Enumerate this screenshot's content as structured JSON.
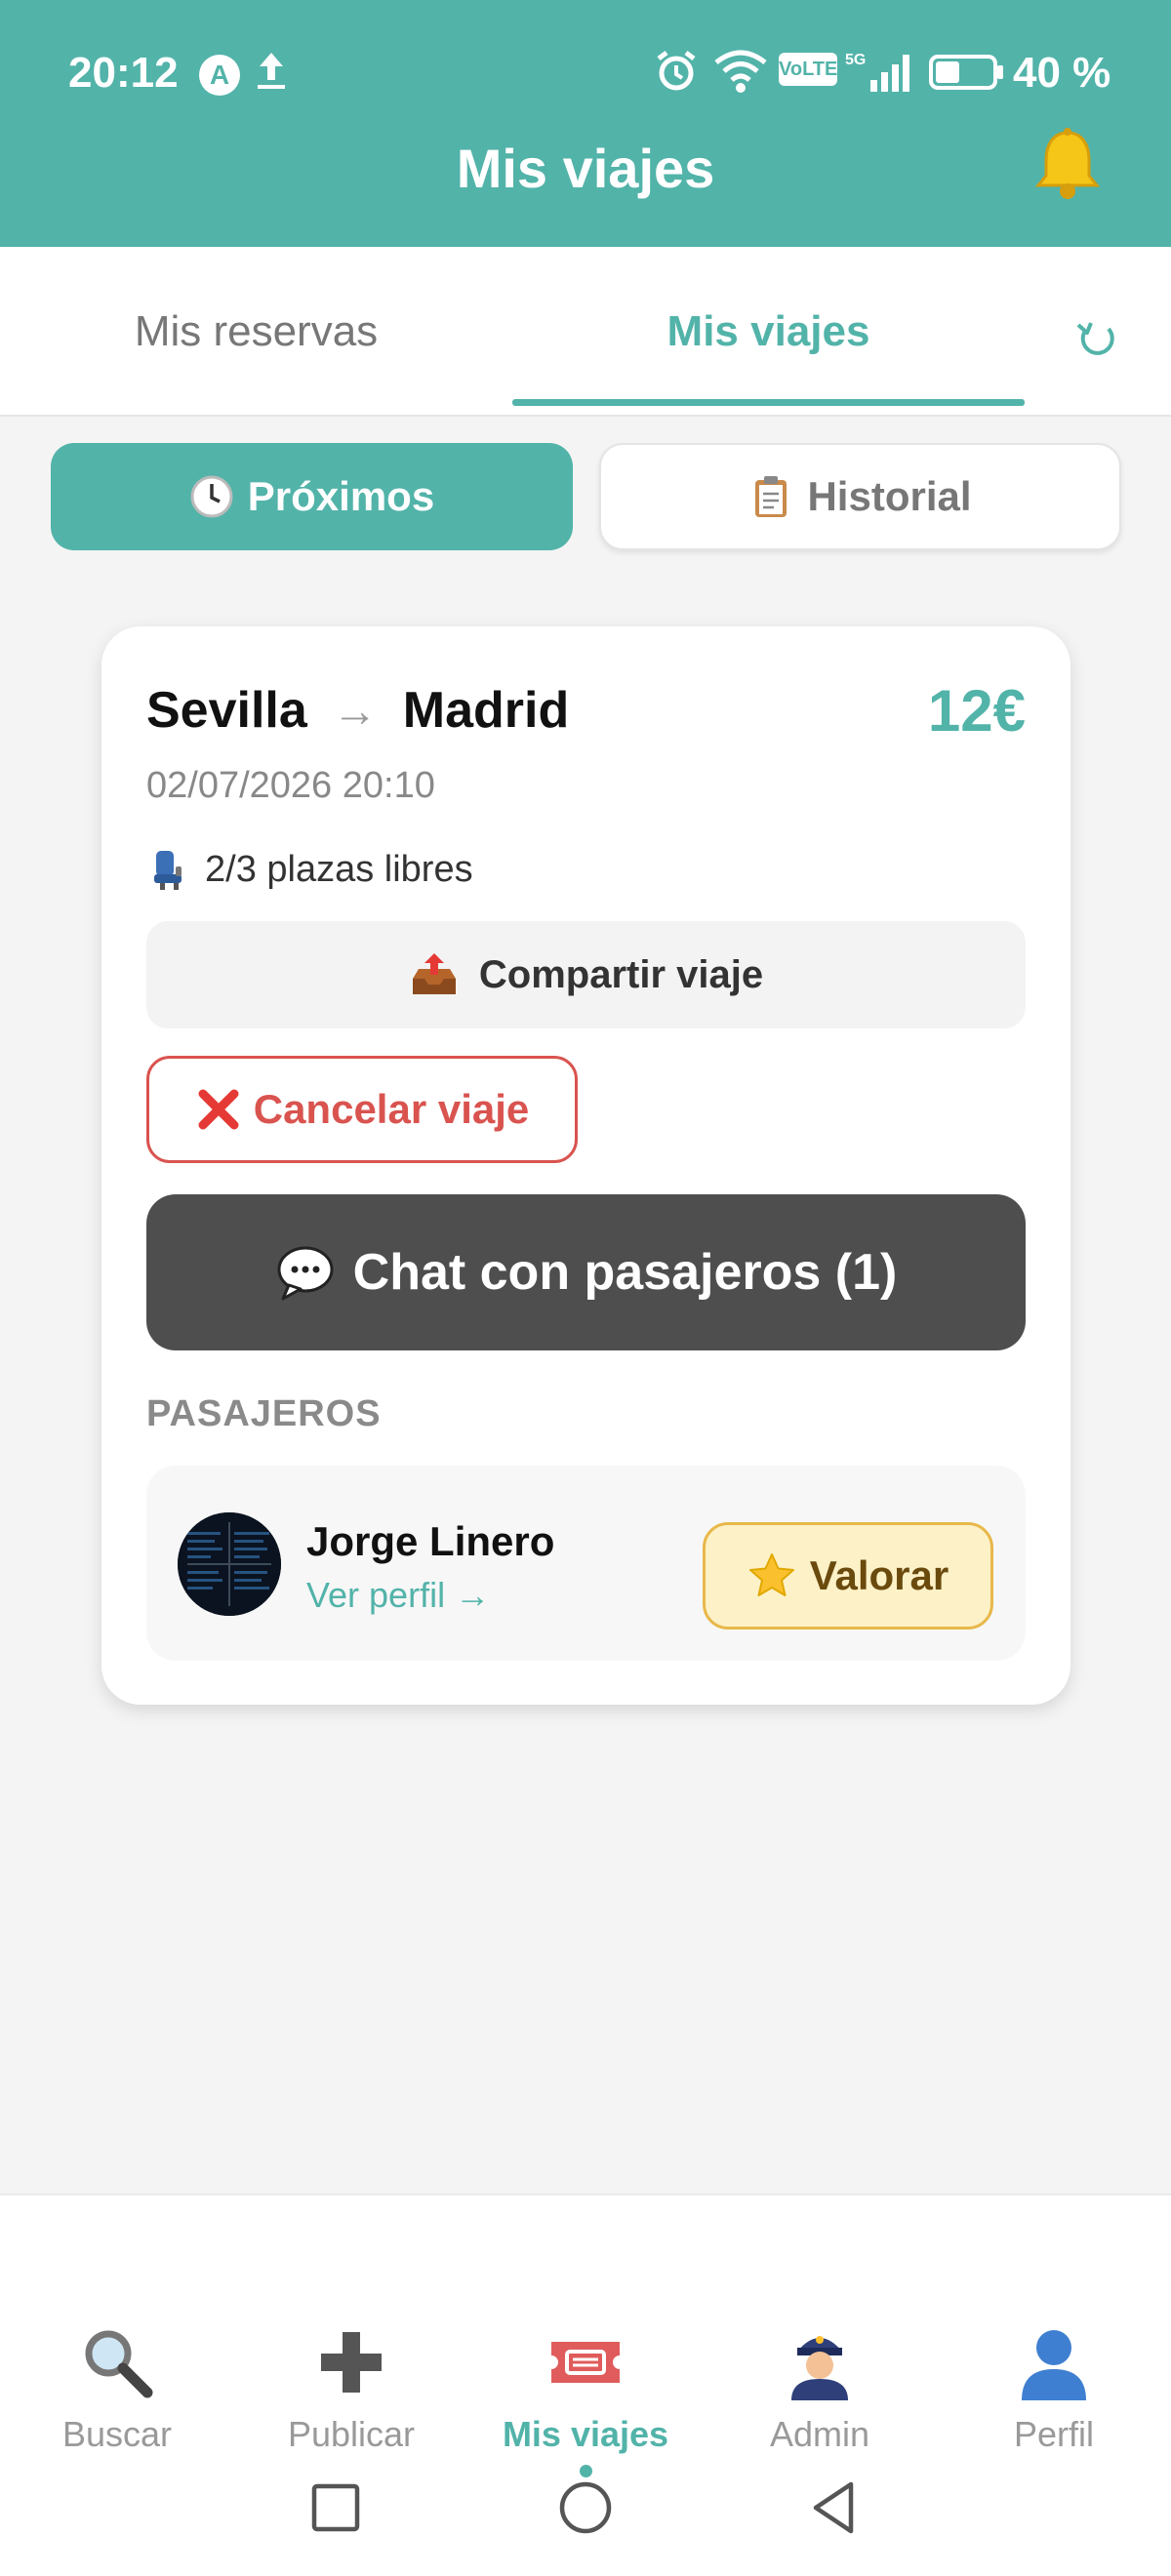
{
  "status_bar": {
    "time": "20:12",
    "battery_text": "40 %",
    "network_badge": "VoLTE",
    "icons": [
      "app-a-icon",
      "upload-icon",
      "alarm-icon",
      "wifi-icon",
      "volte-icon",
      "signal-5g-icon",
      "battery-icon"
    ]
  },
  "header": {
    "title": "Mis viajes",
    "notification_icon": "bell-icon",
    "background_color": "#52b3a9"
  },
  "tabs": {
    "items": [
      {
        "label": "Mis reservas",
        "active": false
      },
      {
        "label": "Mis viajes",
        "active": true
      }
    ],
    "refresh_icon": "refresh-icon"
  },
  "segment": {
    "proximos": {
      "icon": "clock-icon",
      "label": "Próximos",
      "active": true
    },
    "historial": {
      "icon": "clipboard-icon",
      "label": "Historial",
      "active": false
    }
  },
  "trip": {
    "origin": "Sevilla",
    "arrow": "→",
    "destination": "Madrid",
    "price": "12€",
    "datetime": "02/07/2026 20:10",
    "seats_text": "2/3 plazas libres",
    "share_label": "Compartir viaje",
    "cancel_label": "Cancelar viaje",
    "chat_label": "Chat con pasajeros (1)",
    "passengers_heading": "PASAJEROS",
    "passengers": [
      {
        "name": "Jorge Linero",
        "profile_link": "Ver perfil →",
        "rate_label": "Valorar"
      }
    ]
  },
  "bottom_nav": {
    "items": [
      {
        "label": "Buscar",
        "icon": "search-icon",
        "active": false
      },
      {
        "label": "Publicar",
        "icon": "plus-icon",
        "active": false
      },
      {
        "label": "Mis viajes",
        "icon": "ticket-icon",
        "active": true
      },
      {
        "label": "Admin",
        "icon": "police-officer-icon",
        "active": false
      },
      {
        "label": "Perfil",
        "icon": "user-icon",
        "active": false
      }
    ]
  },
  "colors": {
    "accent": "#52b3a9",
    "danger": "#d9534f",
    "chat_button": "#4e4e4e",
    "rate_button_bg": "#fdf1c7"
  }
}
